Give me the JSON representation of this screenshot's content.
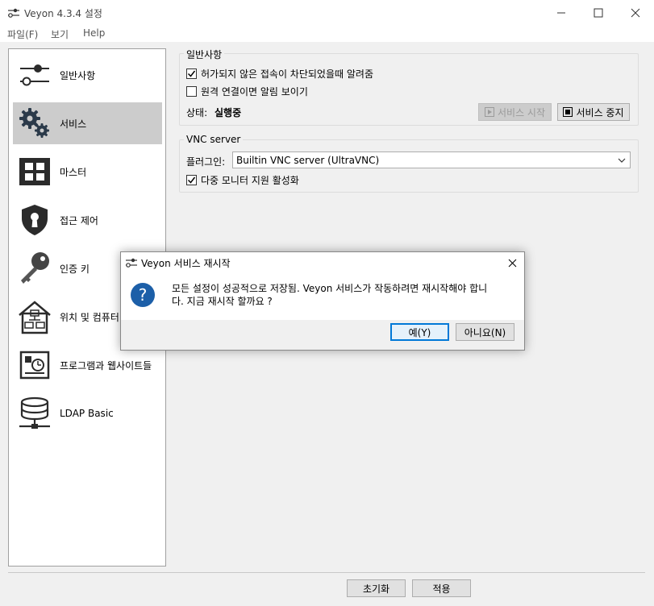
{
  "window": {
    "title": "Veyon  4.3.4 설정",
    "controls": [
      "minimize",
      "maximize",
      "close"
    ]
  },
  "menu": [
    "파일(F)",
    "보기",
    "Help"
  ],
  "sidebar": {
    "items": [
      {
        "label": "일반사항",
        "icon": "sliders-icon",
        "selected": false
      },
      {
        "label": "서비스",
        "icon": "gears-icon",
        "selected": true
      },
      {
        "label": "마스터",
        "icon": "grid-icon",
        "selected": false
      },
      {
        "label": "접근 제어",
        "icon": "shield-lock-icon",
        "selected": false
      },
      {
        "label": "인증 키",
        "icon": "key-icon",
        "selected": false
      },
      {
        "label": "위치 및 컴퓨터",
        "icon": "house-computers-icon",
        "selected": false
      },
      {
        "label": "프로그램과 웹사이트들",
        "icon": "app-clock-icon",
        "selected": false
      },
      {
        "label": "LDAP Basic",
        "icon": "database-network-icon",
        "selected": false
      }
    ]
  },
  "general": {
    "title": "일반사항",
    "notify_blocked": {
      "label": "허가되지 않은 접속이 차단되었을때 알려줌",
      "checked": true
    },
    "notify_remote": {
      "label": "원격 연결이면 알림 보이기",
      "checked": false
    },
    "status_label": "상태:",
    "status_value": "실행중",
    "start_button": "서비스 시작",
    "stop_button": "서비스 중지"
  },
  "vnc": {
    "title": "VNC server",
    "plugin_label": "플러그인:",
    "plugin_value": "Builtin VNC server (UltraVNC)",
    "multi_monitor": {
      "label": "다중 모니터 지원 활성화",
      "checked": true
    }
  },
  "footer": {
    "reset_button": "초기화",
    "apply_button": "적용"
  },
  "dialog": {
    "title": "Veyon 서비스 재시작",
    "message_line1": "모든 설정이 성공적으로 저장됨. Veyon 서비스가 작동하려면 재시작해야 합니",
    "message_line2": "다. 지금 재시작 할까요 ?",
    "yes_button": "예(Y)",
    "no_button": "아니요(N)"
  },
  "colors": {
    "accent_blue": "#1e64b4",
    "question_icon": "#1c5fa8",
    "selected_item": "#cccccc",
    "icon_dark": "#2b2b2b"
  }
}
